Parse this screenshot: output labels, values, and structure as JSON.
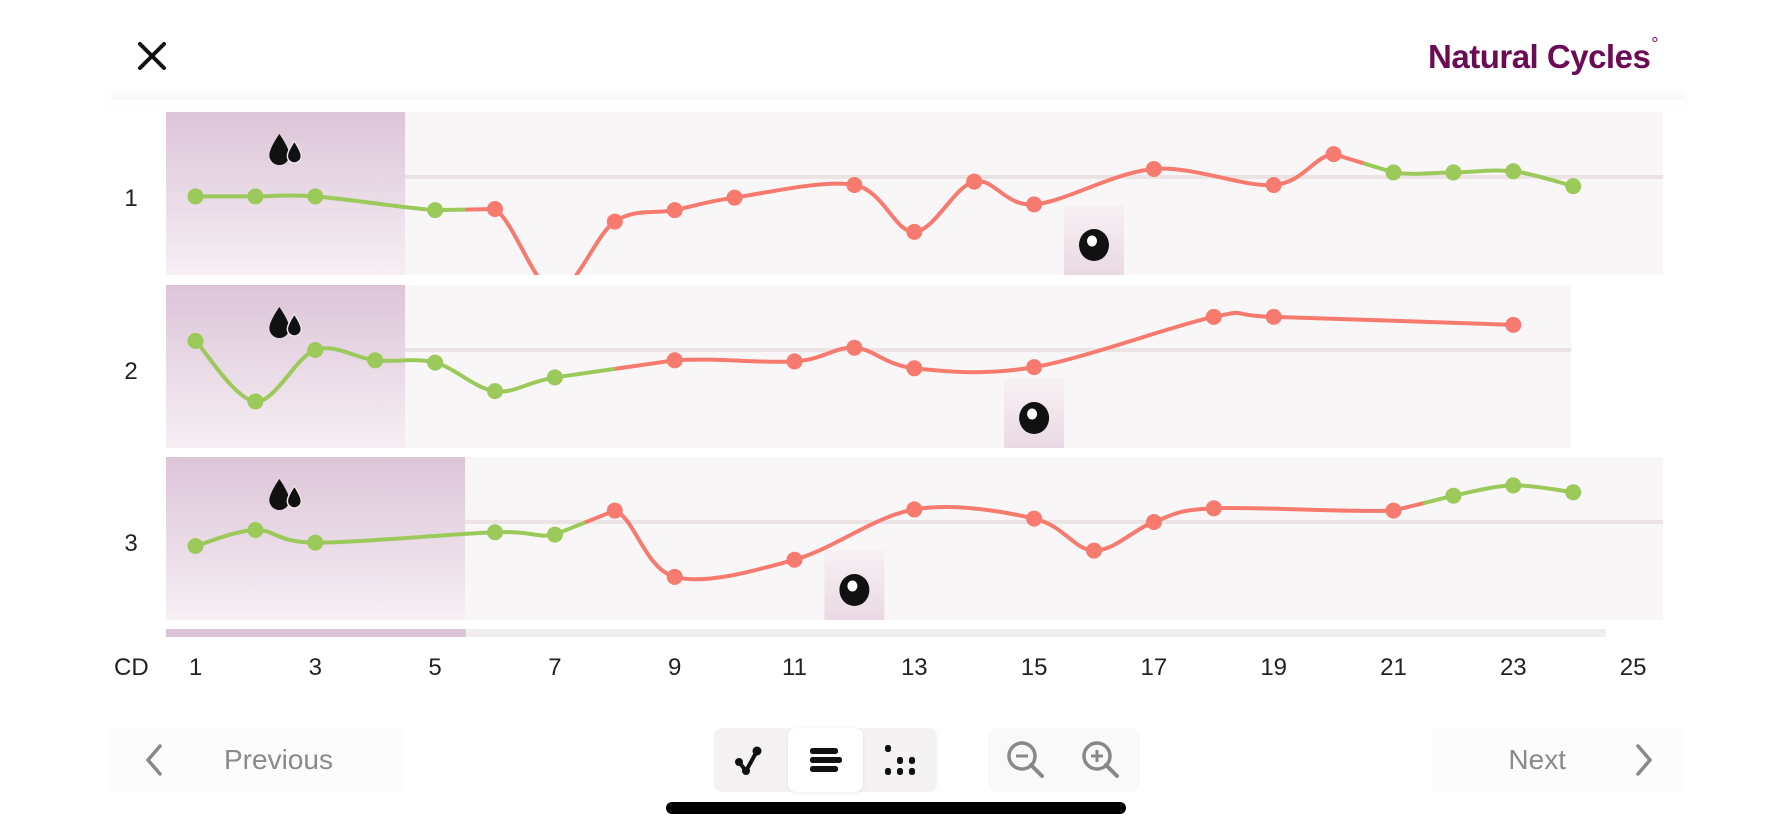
{
  "header": {
    "close_label": "close",
    "logo_text": "Natural Cycles",
    "logo_mark": "°"
  },
  "colors": {
    "brand": "#6b0a55",
    "green": "#9bc95a",
    "red": "#f77a6f",
    "period_band": "#dcc5d8",
    "row_bg": "#f9f6f7",
    "midline": "#ebe3e4",
    "ovulation_band": "#ead9e4"
  },
  "chart_data": {
    "type": "line",
    "title": "",
    "xlabel": "CD",
    "ylabel": "",
    "x_tick_labels": [
      "1",
      "3",
      "5",
      "7",
      "9",
      "11",
      "13",
      "15",
      "17",
      "19",
      "21",
      "23",
      "25"
    ],
    "xlim": [
      1,
      25
    ],
    "value_note": "relative temperature deviation from cover line (arbitrary units, + above)",
    "rows": [
      {
        "label": "1",
        "length": 25,
        "period_days": [
          1,
          4
        ],
        "ovulation_day": 16,
        "points": [
          {
            "day": 1,
            "v": -17,
            "status": "green"
          },
          {
            "day": 2,
            "v": -17,
            "status": "green"
          },
          {
            "day": 3,
            "v": -17,
            "status": "green"
          },
          {
            "day": 5,
            "v": -29,
            "status": "green"
          },
          {
            "day": 6,
            "v": -28,
            "status": "red"
          },
          {
            "day": 7,
            "v": -100,
            "status": "red",
            "hidden": true
          },
          {
            "day": 8,
            "v": -39,
            "status": "red"
          },
          {
            "day": 9,
            "v": -29,
            "status": "red"
          },
          {
            "day": 10,
            "v": -18,
            "status": "red"
          },
          {
            "day": 12,
            "v": -7,
            "status": "red"
          },
          {
            "day": 13,
            "v": -48,
            "status": "red"
          },
          {
            "day": 14,
            "v": -4,
            "status": "red"
          },
          {
            "day": 15,
            "v": -24,
            "status": "red"
          },
          {
            "day": 17,
            "v": 7,
            "status": "red"
          },
          {
            "day": 19,
            "v": -7,
            "status": "red"
          },
          {
            "day": 20,
            "v": 20,
            "status": "red"
          },
          {
            "day": 21,
            "v": 4,
            "status": "green"
          },
          {
            "day": 22,
            "v": 4,
            "status": "green"
          },
          {
            "day": 23,
            "v": 5,
            "status": "green"
          },
          {
            "day": 24,
            "v": -8,
            "status": "green"
          }
        ]
      },
      {
        "label": "2",
        "length": 23,
        "period_days": [
          1,
          4
        ],
        "ovulation_day": 15,
        "points": [
          {
            "day": 1,
            "v": 8,
            "status": "green"
          },
          {
            "day": 2,
            "v": -45,
            "status": "green"
          },
          {
            "day": 3,
            "v": 0,
            "status": "green"
          },
          {
            "day": 4,
            "v": -9,
            "status": "green"
          },
          {
            "day": 5,
            "v": -11,
            "status": "green"
          },
          {
            "day": 6,
            "v": -36,
            "status": "green"
          },
          {
            "day": 7,
            "v": -24,
            "status": "green"
          },
          {
            "day": 9,
            "v": -9,
            "status": "red"
          },
          {
            "day": 11,
            "v": -10,
            "status": "red"
          },
          {
            "day": 12,
            "v": 2,
            "status": "red"
          },
          {
            "day": 13,
            "v": -16,
            "status": "red"
          },
          {
            "day": 15,
            "v": -15,
            "status": "red"
          },
          {
            "day": 18,
            "v": 29,
            "status": "red"
          },
          {
            "day": 19,
            "v": 29,
            "status": "red"
          },
          {
            "day": 23,
            "v": 22,
            "status": "red"
          }
        ]
      },
      {
        "label": "3",
        "length": 25,
        "period_days": [
          1,
          5
        ],
        "ovulation_day": 12,
        "points": [
          {
            "day": 1,
            "v": -21,
            "status": "green"
          },
          {
            "day": 2,
            "v": -7,
            "status": "green"
          },
          {
            "day": 3,
            "v": -18,
            "status": "green"
          },
          {
            "day": 6,
            "v": -9,
            "status": "green"
          },
          {
            "day": 7,
            "v": -11,
            "status": "green"
          },
          {
            "day": 8,
            "v": 10,
            "status": "red"
          },
          {
            "day": 9,
            "v": -48,
            "status": "red"
          },
          {
            "day": 11,
            "v": -33,
            "status": "red"
          },
          {
            "day": 13,
            "v": 11,
            "status": "red"
          },
          {
            "day": 15,
            "v": 3,
            "status": "red"
          },
          {
            "day": 16,
            "v": -25,
            "status": "red"
          },
          {
            "day": 17,
            "v": 0,
            "status": "red"
          },
          {
            "day": 18,
            "v": 12,
            "status": "red"
          },
          {
            "day": 21,
            "v": 10,
            "status": "red"
          },
          {
            "day": 22,
            "v": 23,
            "status": "green"
          },
          {
            "day": 23,
            "v": 32,
            "status": "green"
          },
          {
            "day": 24,
            "v": 26,
            "status": "green"
          }
        ]
      }
    ]
  },
  "footer": {
    "previous_label": "Previous",
    "next_label": "Next",
    "view_modes": [
      "graph-view",
      "cycle-rows-view",
      "dots-view"
    ],
    "active_view": "cycle-rows-view"
  }
}
